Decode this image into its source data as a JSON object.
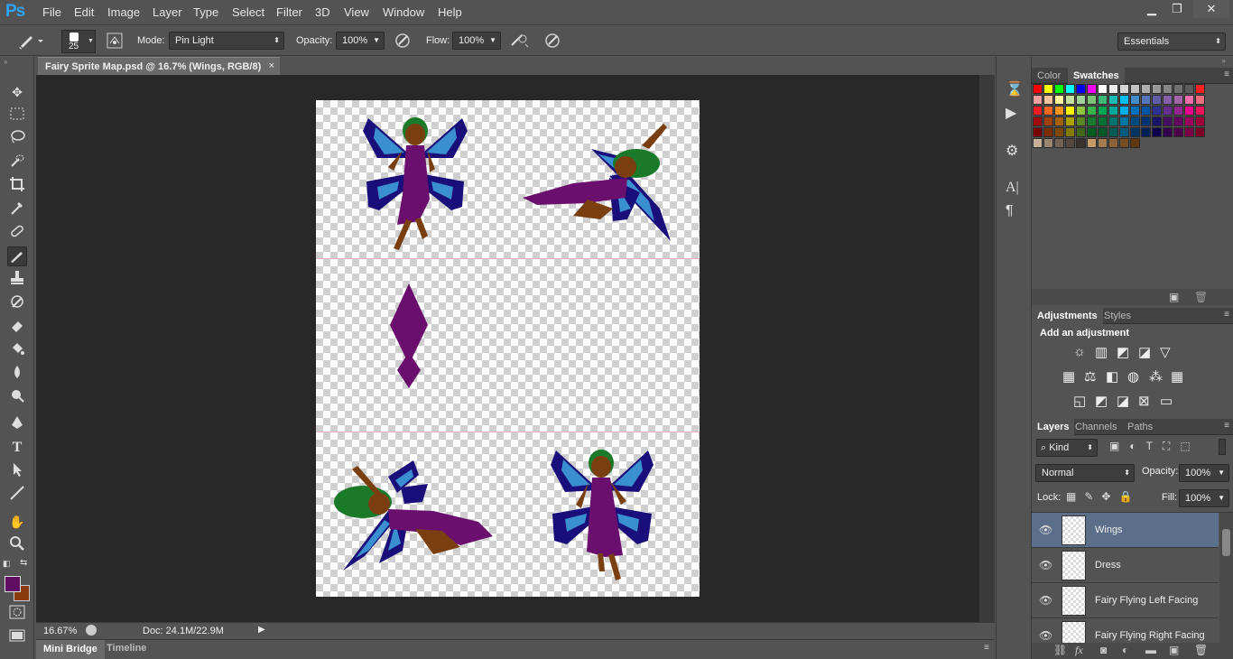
{
  "app": {
    "logo": "Ps"
  },
  "menu": [
    "File",
    "Edit",
    "Image",
    "Layer",
    "Type",
    "Select",
    "Filter",
    "3D",
    "View",
    "Window",
    "Help"
  ],
  "window_controls": {
    "minimize": "▁",
    "restore": "❐",
    "close": "✕"
  },
  "options": {
    "brush_size": "25",
    "mode_label": "Mode:",
    "mode_value": "Pin Light",
    "opacity_label": "Opacity:",
    "opacity_value": "100%",
    "flow_label": "Flow:",
    "flow_value": "100%",
    "workspace_value": "Essentials"
  },
  "document": {
    "tab_title": "Fairy Sprite Map.psd @ 16.7% (Wings, RGB/8)",
    "close": "×"
  },
  "status": {
    "zoom": "16.67%",
    "doc": "Doc: 24.1M/22.9M"
  },
  "bottom_tabs": [
    "Mini Bridge",
    "Timeline"
  ],
  "colors": {
    "foreground": "#5e0d63",
    "background": "#8b3a0f"
  },
  "panels": {
    "color_tabs": [
      "Color",
      "Swatches"
    ],
    "adjust_tabs": [
      "Adjustments",
      "Styles"
    ],
    "adjust_title": "Add an adjustment",
    "layers_tabs": [
      "Layers",
      "Channels",
      "Paths"
    ],
    "kind_label": "Kind",
    "blend_mode": "Normal",
    "layer_opacity_label": "Opacity:",
    "layer_opacity": "100%",
    "lock_label": "Lock:",
    "fill_label": "Fill:",
    "fill_value": "100%",
    "layers": [
      {
        "name": "Wings",
        "selected": true
      },
      {
        "name": "Dress",
        "selected": false
      },
      {
        "name": "Fairy Flying Left Facing",
        "selected": false
      },
      {
        "name": "Fairy Flying Right Facing",
        "selected": false
      }
    ]
  },
  "swatches": [
    "#ff0000",
    "#ffff00",
    "#00ff00",
    "#00ffff",
    "#0000ff",
    "#ff00ff",
    "#ffffff",
    "#ebebeb",
    "#d6d6d6",
    "#c2c2c2",
    "#adadad",
    "#999999",
    "#858585",
    "#707070",
    "#5c5c5c",
    "#ff2020",
    "#f5a0a0",
    "#f8c39a",
    "#fff59c",
    "#c5e19d",
    "#a3d39c",
    "#7cc576",
    "#3cb878",
    "#1abbb4",
    "#00bff3",
    "#438ccb",
    "#5574b9",
    "#605ca8",
    "#8560a8",
    "#a864a8",
    "#f06ea9",
    "#f26d7d",
    "#ee1c24",
    "#f26522",
    "#f7941d",
    "#fff200",
    "#8dc63f",
    "#39b54a",
    "#00a651",
    "#00a99d",
    "#00aeef",
    "#0072bc",
    "#0054a6",
    "#2e3192",
    "#662d91",
    "#92278f",
    "#ec008c",
    "#ed145b",
    "#9e0b0f",
    "#a0410d",
    "#a3620a",
    "#aba000",
    "#598527",
    "#197b30",
    "#007236",
    "#00746b",
    "#0076a3",
    "#004a80",
    "#003471",
    "#1b1464",
    "#440e62",
    "#630460",
    "#9e005d",
    "#9e0039",
    "#790000",
    "#7b2e00",
    "#7d4900",
    "#827b00",
    "#406618",
    "#005e20",
    "#005826",
    "#005952",
    "#005b7f",
    "#003663",
    "#002157",
    "#0d004c",
    "#32004b",
    "#4b0049",
    "#7b0046",
    "#7a0026",
    "#c7b299",
    "#998675",
    "#736357",
    "#534741",
    "#37302d",
    "#c69c6d",
    "#a67c52",
    "#8c6239",
    "#754c24",
    "#603913"
  ],
  "canvas_sprites": {
    "count": 5
  }
}
